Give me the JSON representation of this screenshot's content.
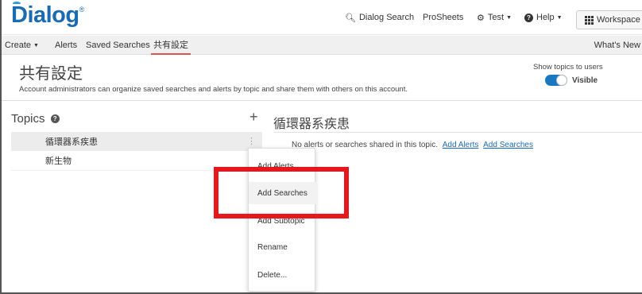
{
  "app": {
    "logo_text": "Dialog",
    "logo_mark": "®"
  },
  "topnav": {
    "search_label": "Dialog Search",
    "prosheets_label": "ProSheets",
    "test_label": "Test",
    "help_label": "Help",
    "workspace_label": "Workspace"
  },
  "subnav": {
    "create_label": "Create",
    "alerts_label": "Alerts",
    "saved_searches_label": "Saved Searches",
    "shared_settings_label": "共有設定",
    "whats_new_label": "What's New"
  },
  "page": {
    "title": "共有設定",
    "description": "Account administrators can organize saved searches and alerts by topic and share them with others on this account.",
    "show_topics_label": "Show topics to users",
    "toggle_label": "Visible",
    "toggle_on": true
  },
  "topics": {
    "title": "Topics",
    "add_symbol": "+",
    "items": [
      {
        "label": "循環器系疾患",
        "selected": true
      },
      {
        "label": "新生物",
        "selected": false
      }
    ]
  },
  "detail": {
    "title": "循環器系疾患",
    "empty_message": "No alerts or searches shared in this topic.",
    "add_alerts_link": "Add Alerts",
    "add_searches_link": "Add Searches"
  },
  "context_menu": {
    "items": [
      {
        "label": "Add Alerts"
      },
      {
        "label": "Add Searches"
      },
      {
        "label": "Add Subtopic"
      },
      {
        "label": "Rename"
      },
      {
        "label": "Delete..."
      }
    ]
  },
  "colors": {
    "brand": "#1a6bb0",
    "highlight": "#e5181e",
    "active_tab_underline": "#d9534f",
    "toggle_on": "#1a78c2"
  }
}
